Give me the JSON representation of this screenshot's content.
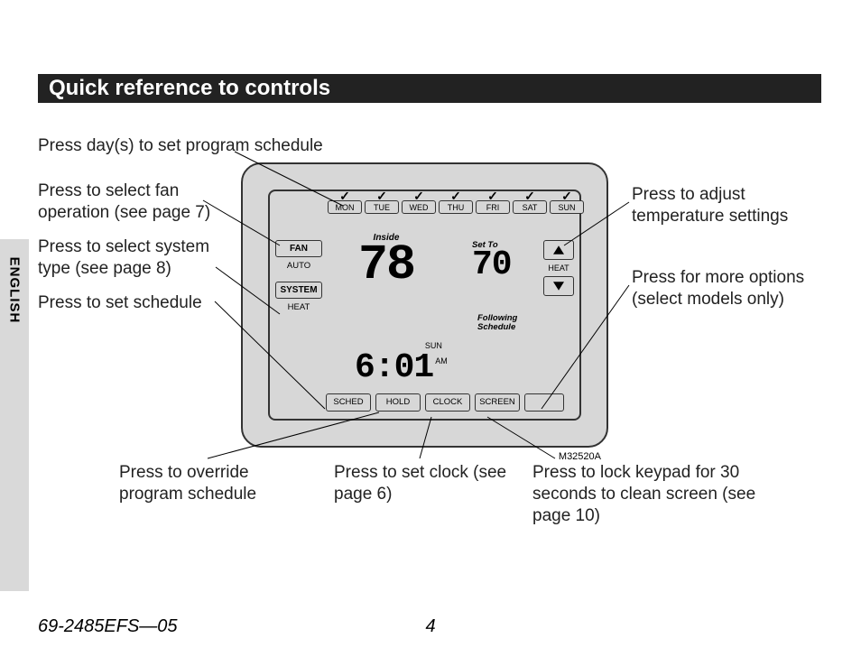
{
  "title": "Quick reference to controls",
  "side_tab": "ENGLISH",
  "doc_id": "69-2485EFS—05",
  "page_num": "4",
  "diagram_id": "M32520A",
  "callouts": {
    "top": "Press day(s) to set program schedule",
    "fan": "Press to select fan operation (see page 7)",
    "system": "Press to select system type (see page 8)",
    "sched_left": "Press to set schedule",
    "temp": "Press to adjust temperature settings",
    "more": "Press for more options (select models only)",
    "override": "Press to override program schedule",
    "clock": "Press to set clock (see page 6)",
    "lock": "Press to lock keypad for 30 seconds to clean screen (see page 10)"
  },
  "days": [
    "MON",
    "TUE",
    "WED",
    "THU",
    "FRI",
    "SAT",
    "SUN"
  ],
  "left_buttons": {
    "fan": "FAN",
    "fan_mode": "AUTO",
    "system": "SYSTEM",
    "system_mode": "HEAT"
  },
  "bottom_buttons": [
    "SCHED",
    "HOLD",
    "CLOCK",
    "SCREEN"
  ],
  "heat_label": "HEAT",
  "display": {
    "inside_label": "Inside",
    "inside_temp": "78",
    "setto_label": "Set To",
    "setto_temp": "70",
    "following": "Following\nSchedule",
    "clock_day": "SUN",
    "clock_time": "6:01",
    "clock_ampm": "AM"
  }
}
